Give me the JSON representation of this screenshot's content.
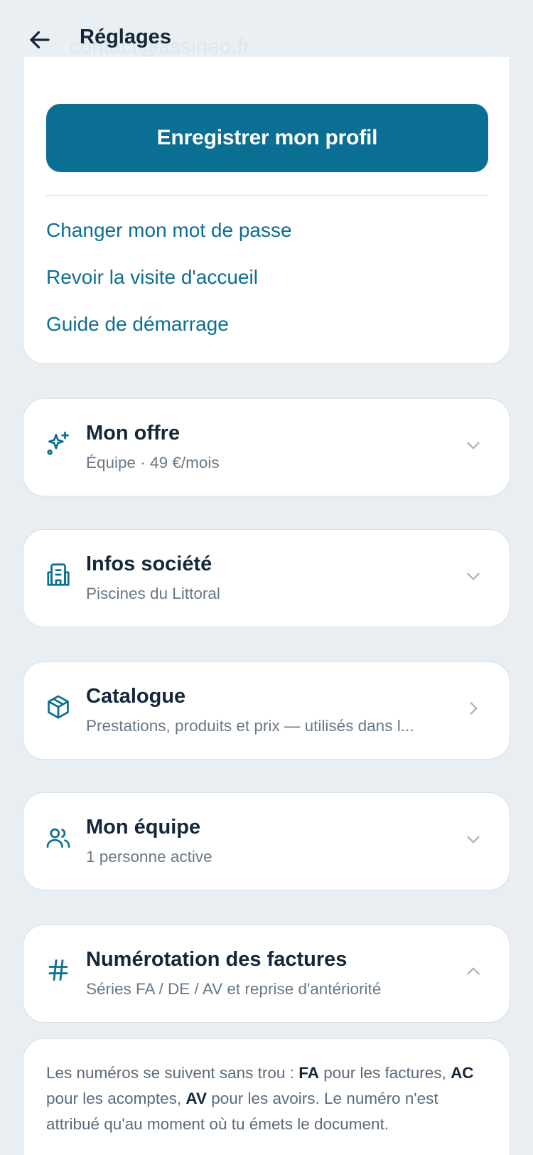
{
  "header": {
    "title": "Réglages",
    "ghost_email": "contact@assineo.fr"
  },
  "profile": {
    "save_label": "Enregistrer mon profil",
    "links": [
      "Changer mon mot de passe",
      "Revoir la visite d'accueil",
      "Guide de démarrage"
    ]
  },
  "sections": [
    {
      "icon": "sparkles-icon",
      "title": "Mon offre",
      "subtitle": "Équipe · 49 €/mois",
      "chevron": "chevron-down-icon"
    },
    {
      "icon": "building-icon",
      "title": "Infos société",
      "subtitle": "Piscines du Littoral",
      "chevron": "chevron-down-icon"
    },
    {
      "icon": "package-icon",
      "title": "Catalogue",
      "subtitle": "Prestations, produits et prix — utilisés dans l...",
      "chevron": "chevron-right-icon"
    },
    {
      "icon": "users-icon",
      "title": "Mon équipe",
      "subtitle": "1 personne active",
      "chevron": "chevron-down-icon"
    },
    {
      "icon": "hash-icon",
      "title": "Numérotation des factures",
      "subtitle": "Séries FA / DE / AV et reprise d'antériorité",
      "chevron": "chevron-up-icon"
    }
  ],
  "numbering_info": {
    "code_fa": "FA",
    "text_fa": " pour les factures,",
    "code_ac": "AC",
    "text_ac": " pour les acomptes, ",
    "code_av": "AV",
    "text_av": " pour les avoirs. Le numéro n'est attribué qu'au moment où tu émets le document.",
    "intro": "Les numéros se suivent sans trou : "
  },
  "colors": {
    "accent": "#0b6e93",
    "background": "#e9eef3",
    "text": "#14273a",
    "muted": "#687888"
  }
}
